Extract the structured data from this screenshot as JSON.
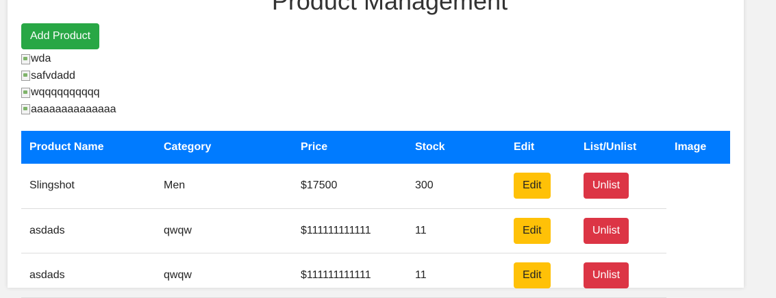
{
  "page": {
    "title": "Product Management"
  },
  "toolbar": {
    "add_product_label": "Add Product"
  },
  "broken_images": [
    {
      "alt": "wda"
    },
    {
      "alt": "safvdadd"
    },
    {
      "alt": "wqqqqqqqqqq"
    },
    {
      "alt": "aaaaaaaaaaaaaa"
    }
  ],
  "table": {
    "headers": [
      "Product Name",
      "Category",
      "Price",
      "Stock",
      "Edit",
      "List/Unlist",
      "Image"
    ],
    "rows": [
      {
        "name": "Slingshot",
        "category": "Men",
        "price": "$17500",
        "stock": "300",
        "edit_label": "Edit",
        "list_label": "Unlist"
      },
      {
        "name": "asdads",
        "category": "qwqw",
        "price": "$111111111111",
        "stock": "11",
        "edit_label": "Edit",
        "list_label": "Unlist"
      },
      {
        "name": "asdads",
        "category": "qwqw",
        "price": "$111111111111",
        "stock": "11",
        "edit_label": "Edit",
        "list_label": "Unlist"
      }
    ]
  },
  "colors": {
    "header_bg": "#007bff",
    "add_button": "#28a745",
    "edit_button": "#ffc107",
    "unlist_button": "#dc3545"
  }
}
